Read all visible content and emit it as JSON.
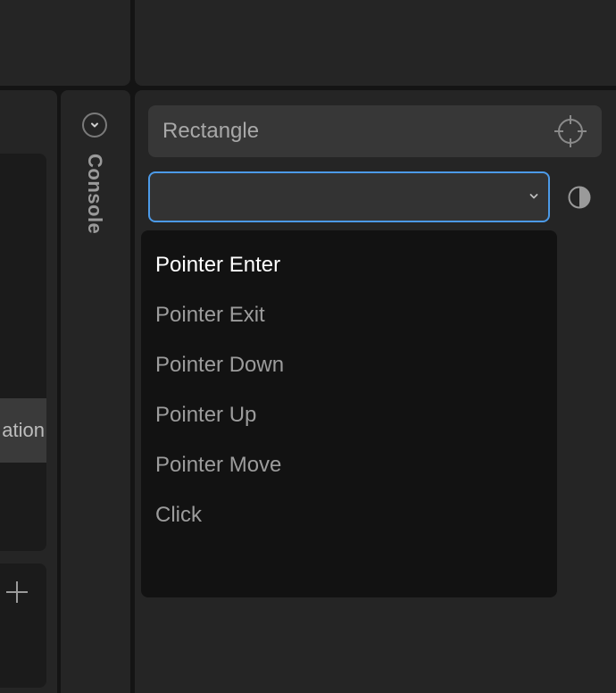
{
  "left_panel": {
    "selected_item_label": "ation"
  },
  "console": {
    "label": "Console"
  },
  "inspector": {
    "name_value": "Rectangle",
    "event_select_value": "",
    "event_options": [
      "Pointer Enter",
      "Pointer Exit",
      "Pointer Down",
      "Pointer Up",
      "Pointer Move",
      "Click"
    ],
    "highlighted_option": "Pointer Enter"
  },
  "colors": {
    "focus_border": "#4c9ae8",
    "panel_bg": "#252525",
    "dropdown_bg": "#121212"
  }
}
